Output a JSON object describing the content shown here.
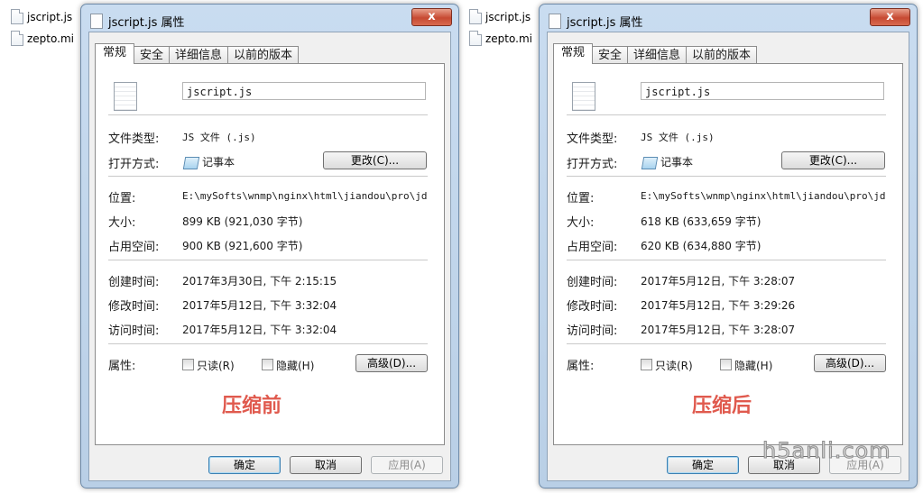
{
  "background_files": [
    {
      "name": "jscript.js"
    },
    {
      "name": "zepto.mi"
    }
  ],
  "dialogs": [
    {
      "title": "jscript.js 属性",
      "close_label": "x",
      "tabs": [
        "常规",
        "安全",
        "详细信息",
        "以前的版本"
      ],
      "file_name": "jscript.js",
      "type_label": "文件类型:",
      "type_value": "JS 文件 (.js)",
      "open_label": "打开方式:",
      "open_app": "记事本",
      "change_button": "更改(C)...",
      "location_label": "位置:",
      "location_value": "E:\\mySofts\\wnmp\\nginx\\html\\jiandou\\pro\\jd",
      "size_label": "大小:",
      "size_value": "899 KB (921,030 字节)",
      "disk_label": "占用空间:",
      "disk_value": "900 KB (921,600 字节)",
      "created_label": "创建时间:",
      "created_value": "2017年3月30日, 下午 2:15:15",
      "modified_label": "修改时间:",
      "modified_value": "2017年5月12日, 下午 3:32:04",
      "accessed_label": "访问时间:",
      "accessed_value": "2017年5月12日, 下午 3:32:04",
      "attr_label": "属性:",
      "readonly_label": "只读(R)",
      "hidden_label": "隐藏(H)",
      "advanced_button": "高级(D)...",
      "annotation": "压缩前",
      "ok_button": "确定",
      "cancel_button": "取消",
      "apply_button": "应用(A)"
    },
    {
      "title": "jscript.js 属性",
      "close_label": "x",
      "tabs": [
        "常规",
        "安全",
        "详细信息",
        "以前的版本"
      ],
      "file_name": "jscript.js",
      "type_label": "文件类型:",
      "type_value": "JS 文件 (.js)",
      "open_label": "打开方式:",
      "open_app": "记事本",
      "change_button": "更改(C)...",
      "location_label": "位置:",
      "location_value": "E:\\mySofts\\wnmp\\nginx\\html\\jiandou\\pro\\jd",
      "size_label": "大小:",
      "size_value": "618 KB (633,659 字节)",
      "disk_label": "占用空间:",
      "disk_value": "620 KB (634,880 字节)",
      "created_label": "创建时间:",
      "created_value": "2017年5月12日, 下午 3:28:07",
      "modified_label": "修改时间:",
      "modified_value": "2017年5月12日, 下午 3:29:26",
      "accessed_label": "访问时间:",
      "accessed_value": "2017年5月12日, 下午 3:28:07",
      "attr_label": "属性:",
      "readonly_label": "只读(R)",
      "hidden_label": "隐藏(H)",
      "advanced_button": "高级(D)...",
      "annotation": "压缩后",
      "ok_button": "确定",
      "cancel_button": "取消",
      "apply_button": "应用(A)"
    }
  ],
  "site_watermark": "h5anli.com",
  "colors": {
    "annotation": "#e05a4e",
    "title_bar": "#c9dcf0",
    "close_button": "#c74a32"
  }
}
